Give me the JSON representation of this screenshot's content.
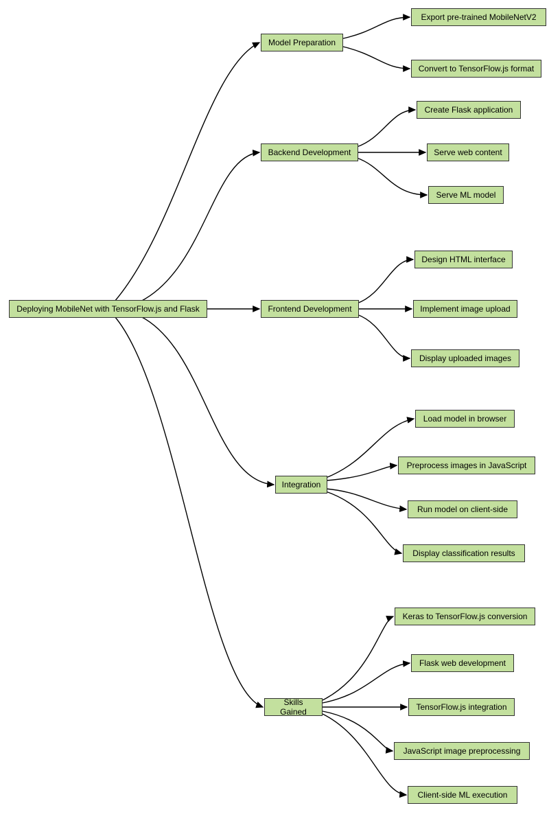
{
  "root": {
    "label": "Deploying MobileNet with TensorFlow.js and Flask"
  },
  "branches": [
    {
      "label": "Model Preparation",
      "leaves": [
        "Export pre-trained MobileNetV2",
        "Convert to TensorFlow.js format"
      ]
    },
    {
      "label": "Backend Development",
      "leaves": [
        "Create Flask application",
        "Serve web content",
        "Serve ML model"
      ]
    },
    {
      "label": "Frontend Development",
      "leaves": [
        "Design HTML interface",
        "Implement image upload",
        "Display uploaded images"
      ]
    },
    {
      "label": "Integration",
      "leaves": [
        "Load model in browser",
        "Preprocess images in JavaScript",
        "Run model on client-side",
        "Display classification results"
      ]
    },
    {
      "label": "Skills Gained",
      "leaves": [
        "Keras to TensorFlow.js conversion",
        "Flask web development",
        "TensorFlow.js integration",
        "JavaScript image preprocessing",
        "Client-side ML execution"
      ]
    }
  ]
}
